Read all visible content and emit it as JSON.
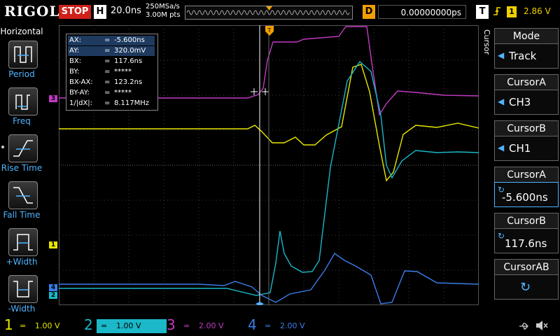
{
  "header": {
    "logo": "RIGOL",
    "run_state": "STOP",
    "timebase_label": "H",
    "timebase_value": "20.0ns",
    "sample_rate": "250MSa/s",
    "memory_depth": "3.00M pts",
    "delay_label": "D",
    "delay_value": "0.00000000ps",
    "trigger_label": "T",
    "trigger_channel": "1",
    "trigger_level": "2.86 V"
  },
  "left_menu": {
    "title": "Horizontal",
    "items": [
      {
        "label": "Period",
        "icon": "period-icon"
      },
      {
        "label": "Freq",
        "icon": "freq-icon"
      },
      {
        "label": "Rise Time",
        "icon": "rise-time-icon"
      },
      {
        "label": "Fall Time",
        "icon": "fall-time-icon"
      },
      {
        "label": "+Width",
        "icon": "pos-width-icon"
      },
      {
        "label": "-Width",
        "icon": "neg-width-icon"
      }
    ]
  },
  "cursor_info": {
    "rows": [
      {
        "key": "AX:",
        "value": "-5.600ns"
      },
      {
        "key": "AY:",
        "value": "320.0mV"
      },
      {
        "key": "BX:",
        "value": "117.6ns"
      },
      {
        "key": "BY:",
        "value": "*****"
      },
      {
        "key": "BX-AX:",
        "value": "123.2ns"
      },
      {
        "key": "BY-AY:",
        "value": "*****"
      },
      {
        "key": "1/|dX|:",
        "value": "8.117MHz"
      }
    ],
    "eq": "="
  },
  "right_menu": {
    "vertical_title": "Cursor",
    "mode_title": "Mode",
    "mode_value": "Track",
    "cursor_a_title": "CursorA",
    "cursor_a_value": "CH3",
    "cursor_b_title": "CursorB",
    "cursor_b_value": "CH1",
    "cursor_a_pos_title": "CursorA",
    "cursor_a_pos_value": "-5.600ns",
    "cursor_b_pos_title": "CursorB",
    "cursor_b_pos_value": "117.6ns",
    "cursor_ab_title": "CursorAB"
  },
  "channels": [
    {
      "num": "1",
      "scale": "1.00 V",
      "color": "#e8e800"
    },
    {
      "num": "2",
      "scale": "1.00 V",
      "color": "#1ab8c8"
    },
    {
      "num": "3",
      "scale": "2.00 V",
      "color": "#c23bc2"
    },
    {
      "num": "4",
      "scale": "2.00 V",
      "color": "#3a7ee8"
    }
  ],
  "markers": {
    "ch1": "1",
    "ch2": "2",
    "ch3": "3",
    "ch4": "4",
    "trig": "T"
  },
  "colors": {
    "accent": "#4fb4ff",
    "stop": "#d0201a",
    "trigger": "#f0a000",
    "grid": "#3c3c3c"
  }
}
